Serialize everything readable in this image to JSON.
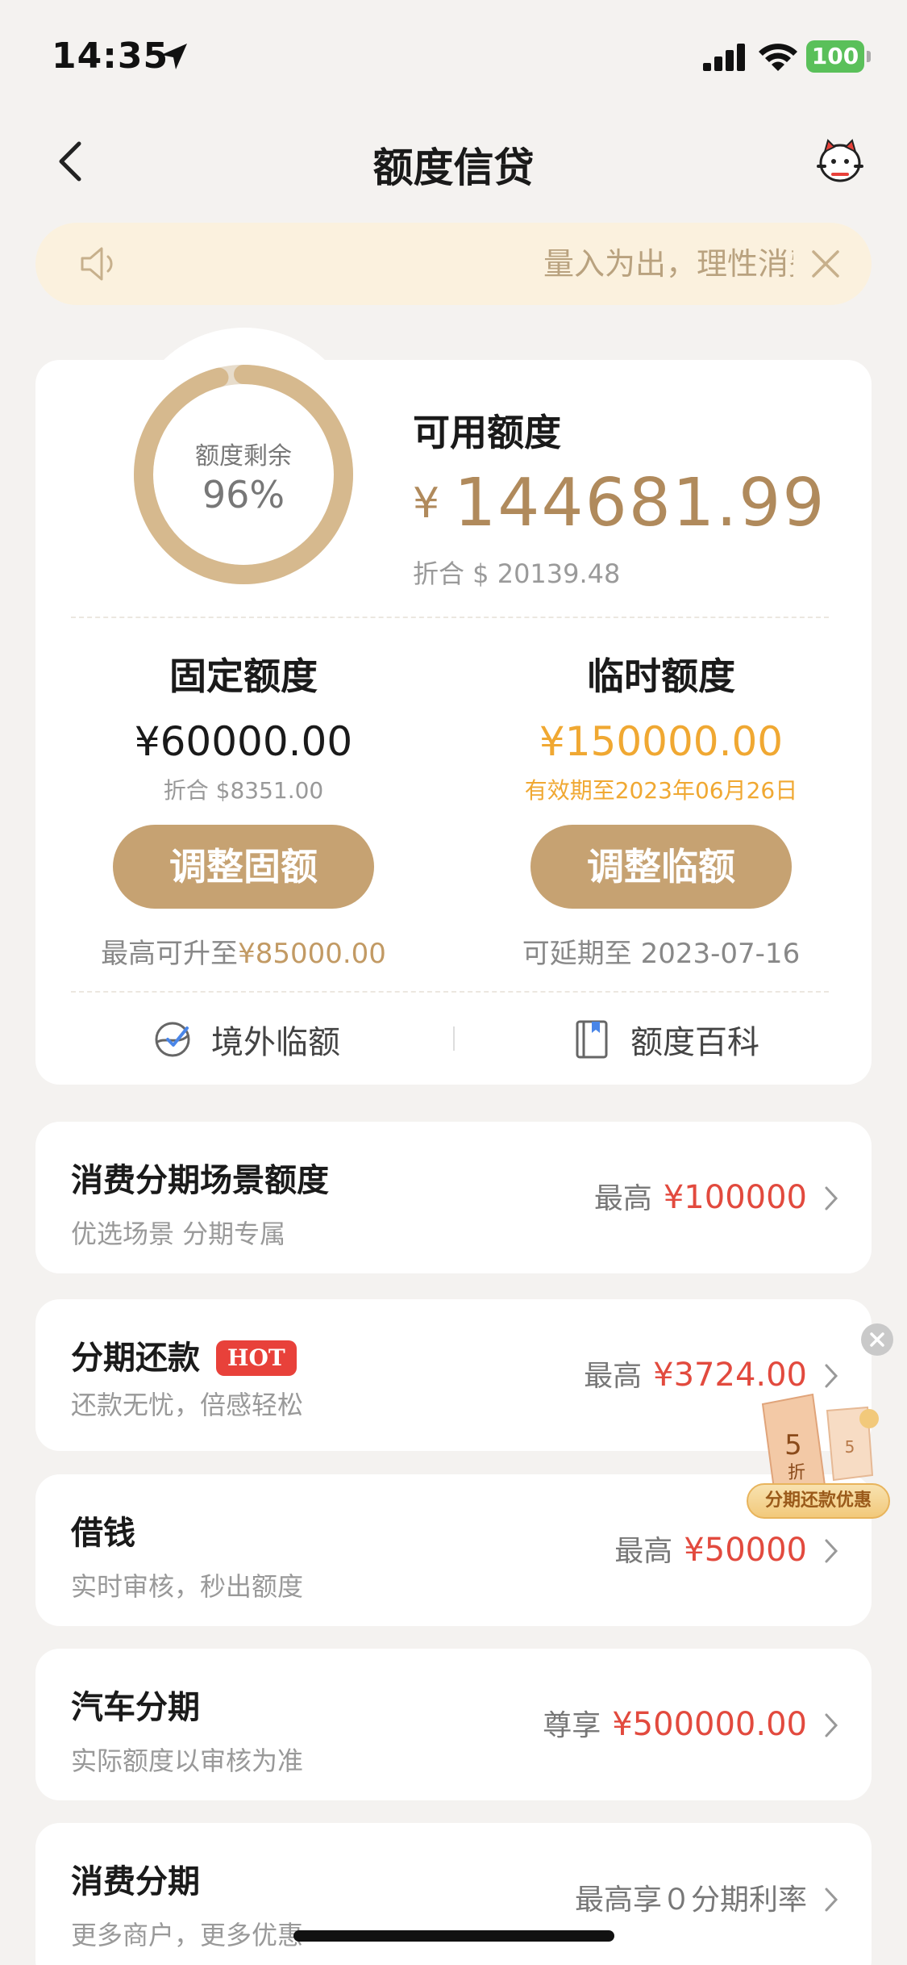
{
  "status_bar": {
    "time": "14:35",
    "battery": "100"
  },
  "nav": {
    "title": "额度信贷"
  },
  "notice": {
    "text": "量入为出，理性消费"
  },
  "overview": {
    "ring_label": "额度剩余",
    "ring_percent": "96%",
    "ring_fraction": 0.96,
    "available_label": "可用额度",
    "currency_symbol": "¥",
    "available_amount": "144681.99",
    "available_usd": "折合 $ 20139.48"
  },
  "fixed_limit": {
    "title": "固定额度",
    "amount": "¥60000.00",
    "usd": "折合 $8351.00",
    "button": "调整固额",
    "note_prefix": "最高可升至",
    "note_value": "¥85000.00"
  },
  "temp_limit": {
    "title": "临时额度",
    "amount": "¥150000.00",
    "validity": "有效期至2023年06月26日",
    "button": "调整临额",
    "note": "可延期至 2023-07-16"
  },
  "links": {
    "overseas": "境外临额",
    "wiki": "额度百科"
  },
  "list": [
    {
      "title": "消费分期场景额度",
      "sub": "优选场景 分期专属",
      "prefix": "最高",
      "value": "¥100000"
    },
    {
      "title": "分期还款",
      "badge": "HOT",
      "sub": "还款无忧，倍感轻松",
      "prefix": "最高",
      "value": "¥3724.00"
    },
    {
      "title": "借钱",
      "sub": "实时审核，秒出额度",
      "prefix": "最高",
      "value": "¥50000"
    },
    {
      "title": "汽车分期",
      "sub": "实际额度以审核为准",
      "prefix": "尊享",
      "value": "¥500000.00"
    },
    {
      "title": "消费分期",
      "sub": "更多商户，更多优惠",
      "prefix": "最高享０分期利率",
      "value": ""
    }
  ],
  "promo": {
    "discount": "5",
    "discount_unit": "折",
    "label": "分期还款优惠"
  },
  "colors": {
    "gold": "#c6a272",
    "gold_text": "#b08a5c",
    "orange": "#f0a832",
    "red": "#e24a3e",
    "notice_bg": "#fbf1de"
  }
}
